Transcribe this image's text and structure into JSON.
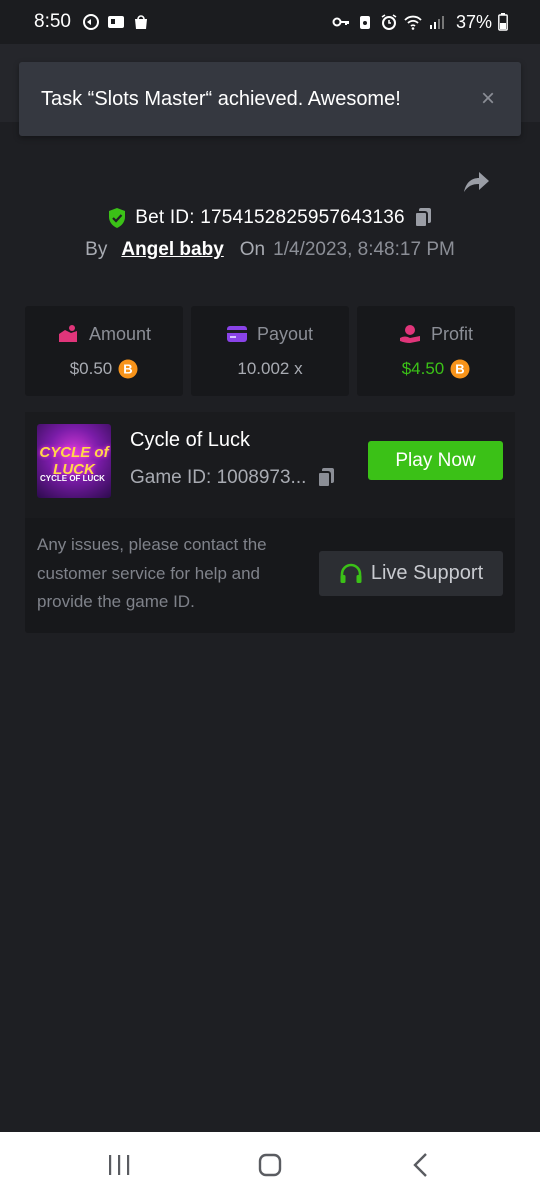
{
  "status_bar": {
    "time": "8:50",
    "battery": "37%"
  },
  "toast": {
    "message": "Task “Slots Master“ achieved. Awesome!",
    "close_glyph": "×"
  },
  "bet": {
    "bet_id_text": "Bet ID: 1754152825957643136",
    "by_label": "By",
    "user": "Angel baby",
    "on_label": "On",
    "datetime": "1/4/2023, 8:48:17 PM"
  },
  "stats": [
    {
      "label": "Amount",
      "value": "$0.50",
      "icon": "amount-icon",
      "coin": true
    },
    {
      "label": "Payout",
      "value": "10.002 x",
      "icon": "card-icon",
      "coin": false
    },
    {
      "label": "Profit",
      "value": "$4.50",
      "icon": "profit-hand-icon",
      "coin": true
    }
  ],
  "game": {
    "name": "Cycle of Luck",
    "game_id_text": "Game ID: 1008973...",
    "thumb_title": "CYCLE of LUCK",
    "thumb_sub": "CYCLE OF LUCK",
    "play_label": "Play Now",
    "issue_text": "Any issues, please contact the customer service for help and provide the game ID.",
    "support_label": "Live Support"
  },
  "colors": {
    "background": "#1e1f23",
    "accent_green": "#3bc117",
    "muted_text": "#8b8e96"
  }
}
